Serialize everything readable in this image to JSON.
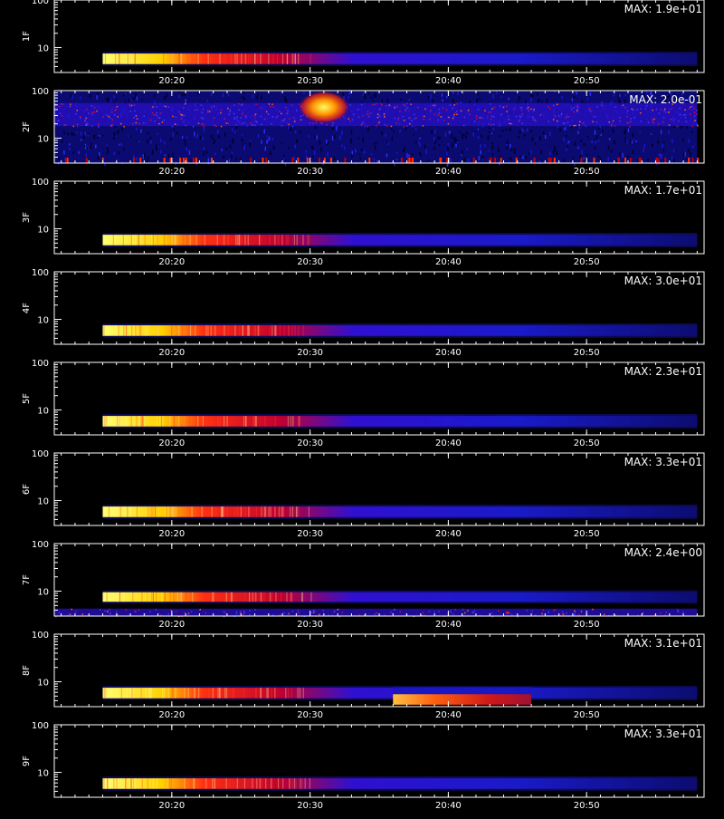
{
  "figure": {
    "bottom_label": ""
  },
  "chart_data": [
    {
      "type": "heatmap",
      "panel": "1F",
      "ylabel": "1F",
      "max_label": "MAX: 1.9e+01",
      "ylim": [
        3,
        100
      ],
      "yscale": "log",
      "yticks": [
        "100",
        "10"
      ],
      "xlim": [
        "20:11:30",
        "20:58:30"
      ],
      "xticks": [
        "20:20",
        "20:30",
        "20:40",
        "20:50"
      ],
      "features": [
        {
          "band": [
            4.5,
            7.5
          ],
          "t": [
            "20:15:00",
            "20:58:00"
          ],
          "profile": "decay"
        }
      ]
    },
    {
      "type": "heatmap",
      "panel": "2F",
      "ylabel": "2F",
      "max_label": "MAX: 2.0e-01",
      "ylim": [
        3,
        100
      ],
      "yscale": "log",
      "yticks": [
        "100",
        "10"
      ],
      "xlim": [
        "20:11:30",
        "20:58:30"
      ],
      "xticks": [
        "20:20",
        "20:30",
        "20:40",
        "20:50"
      ],
      "features": [
        {
          "band": [
            3,
            100
          ],
          "t": [
            "20:11:30",
            "20:58:00"
          ],
          "profile": "noise"
        },
        {
          "band": [
            18,
            55
          ],
          "t": [
            "20:11:30",
            "20:58:00"
          ],
          "profile": "band"
        },
        {
          "band": [
            20,
            100
          ],
          "t": [
            "20:29:30",
            "20:32:30"
          ],
          "profile": "burst"
        }
      ]
    },
    {
      "type": "heatmap",
      "panel": "3F",
      "ylabel": "3F",
      "max_label": "MAX: 1.7e+01",
      "ylim": [
        3,
        100
      ],
      "yscale": "log",
      "yticks": [
        "100",
        "10"
      ],
      "xlim": [
        "20:11:30",
        "20:58:30"
      ],
      "xticks": [
        "20:20",
        "20:30",
        "20:40",
        "20:50"
      ],
      "features": [
        {
          "band": [
            4.5,
            7.5
          ],
          "t": [
            "20:15:00",
            "20:58:00"
          ],
          "profile": "decay"
        }
      ]
    },
    {
      "type": "heatmap",
      "panel": "4F",
      "ylabel": "4F",
      "max_label": "MAX: 3.0e+01",
      "ylim": [
        3,
        100
      ],
      "yscale": "log",
      "yticks": [
        "100",
        "10"
      ],
      "xlim": [
        "20:11:30",
        "20:58:30"
      ],
      "xticks": [
        "20:20",
        "20:30",
        "20:40",
        "20:50"
      ],
      "features": [
        {
          "band": [
            4.5,
            7.5
          ],
          "t": [
            "20:15:00",
            "20:58:00"
          ],
          "profile": "decay"
        }
      ]
    },
    {
      "type": "heatmap",
      "panel": "5F",
      "ylabel": "5F",
      "max_label": "MAX: 2.3e+01",
      "ylim": [
        3,
        100
      ],
      "yscale": "log",
      "yticks": [
        "100",
        "10"
      ],
      "xlim": [
        "20:11:30",
        "20:58:30"
      ],
      "xticks": [
        "20:20",
        "20:30",
        "20:40",
        "20:50"
      ],
      "features": [
        {
          "band": [
            4.5,
            7.5
          ],
          "t": [
            "20:15:00",
            "20:58:00"
          ],
          "profile": "decay"
        }
      ]
    },
    {
      "type": "heatmap",
      "panel": "6F",
      "ylabel": "6F",
      "max_label": "MAX: 3.3e+01",
      "ylim": [
        3,
        100
      ],
      "yscale": "log",
      "yticks": [
        "100",
        "10"
      ],
      "xlim": [
        "20:11:30",
        "20:58:30"
      ],
      "xticks": [
        "20:20",
        "20:30",
        "20:40",
        "20:50"
      ],
      "features": [
        {
          "band": [
            4.5,
            7.5
          ],
          "t": [
            "20:15:00",
            "20:58:00"
          ],
          "profile": "decay"
        }
      ]
    },
    {
      "type": "heatmap",
      "panel": "7F",
      "ylabel": "7F",
      "max_label": "MAX: 2.4e+00",
      "ylim": [
        3,
        100
      ],
      "yscale": "log",
      "yticks": [
        "100",
        "10"
      ],
      "xlim": [
        "20:11:30",
        "20:58:30"
      ],
      "xticks": [
        "20:20",
        "20:30",
        "20:40",
        "20:50"
      ],
      "features": [
        {
          "band": [
            6,
            9.5
          ],
          "t": [
            "20:15:00",
            "20:58:00"
          ],
          "profile": "decay"
        },
        {
          "band": [
            3,
            4.3
          ],
          "t": [
            "20:11:30",
            "20:58:00"
          ],
          "profile": "band"
        }
      ]
    },
    {
      "type": "heatmap",
      "panel": "8F",
      "ylabel": "8F",
      "max_label": "MAX: 3.1e+01",
      "ylim": [
        3,
        100
      ],
      "yscale": "log",
      "yticks": [
        "100",
        "10"
      ],
      "xlim": [
        "20:11:30",
        "20:58:30"
      ],
      "xticks": [
        "20:20",
        "20:30",
        "20:40",
        "20:50"
      ],
      "features": [
        {
          "band": [
            4.5,
            7.5
          ],
          "t": [
            "20:15:00",
            "20:58:00"
          ],
          "profile": "decay"
        },
        {
          "band": [
            3.3,
            5.5
          ],
          "t": [
            "20:36:00",
            "20:46:00"
          ],
          "profile": "burst"
        }
      ]
    },
    {
      "type": "heatmap",
      "panel": "9F",
      "ylabel": "9F",
      "max_label": "MAX: 3.3e+01",
      "ylim": [
        3,
        100
      ],
      "yscale": "log",
      "yticks": [
        "100",
        "10"
      ],
      "xlim": [
        "20:11:30",
        "20:58:30"
      ],
      "xticks": [
        "20:20",
        "20:30",
        "20:40",
        "20:50"
      ],
      "features": [
        {
          "band": [
            4.5,
            7.5
          ],
          "t": [
            "20:15:00",
            "20:58:00"
          ],
          "profile": "decay"
        }
      ]
    }
  ]
}
